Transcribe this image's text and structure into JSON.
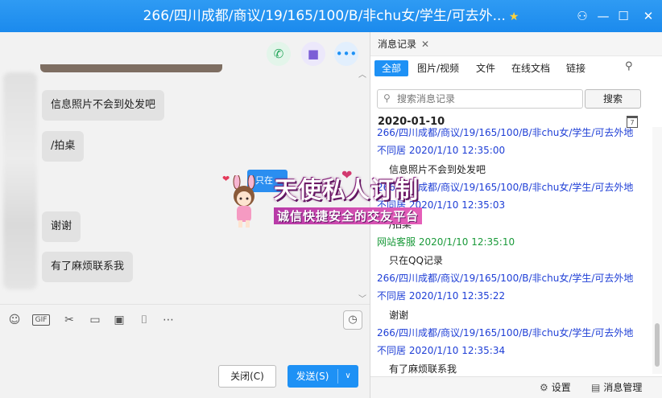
{
  "window": {
    "title": "266/四川成都/商议/19/165/100/B/非chu女/学生/可去外...",
    "title_badge": "★",
    "controls": {
      "skin": "⚇",
      "minimize": "—",
      "maximize": "☐",
      "close": "✕"
    }
  },
  "chat": {
    "actions": [
      {
        "name": "voice-call",
        "glyph": "✆",
        "color": "#22a65a",
        "bg": "#e3f5ea"
      },
      {
        "name": "video-call",
        "glyph": "■",
        "color": "#7b5ed6",
        "bg": "#ece8fb"
      },
      {
        "name": "more",
        "glyph": "•••",
        "color": "#1e91f5",
        "bg": "#e2effd"
      }
    ],
    "messages": [
      {
        "text": "信息照片不会到处发吧"
      },
      {
        "text": "/拍桌"
      },
      {
        "text": "谢谢"
      },
      {
        "text": "有了麻烦联系我"
      }
    ],
    "toolbar": {
      "emoji": "☺",
      "gif": "GIF",
      "screenshot": "✂",
      "folder": "▭",
      "image": "▣",
      "shake": "⌷",
      "more": "⋯",
      "history": "◷"
    },
    "close_label": "关闭(C)",
    "send_label": "发送(S)",
    "send_arrow": "∨"
  },
  "history": {
    "tab_title": "消息记录",
    "tab_close": "✕",
    "filters": [
      "全部",
      "图片/视频",
      "文件",
      "在线文档",
      "链接"
    ],
    "filter_icon": "⚲",
    "search_placeholder": "搜索消息记录",
    "search_button": "搜索",
    "date": "2020-01-10",
    "entries": [
      {
        "sender": "266/四川成都/商议/19/165/100/B/非chu女/学生/可去外地",
        "sender_cont": "不同居",
        "time": "2020/1/10 12:35:00",
        "message": "信息照片不会到处发吧",
        "type": "user"
      },
      {
        "sender": "266/四川成都/商议/19/165/100/B/非chu女/学生/可去外地",
        "sender_cont": "不同居",
        "time": "2020/1/10 12:35:03",
        "message": "/拍桌",
        "type": "user"
      },
      {
        "sender": "网站客服",
        "time": "2020/1/10 12:35:10",
        "message": "只在QQ记录",
        "type": "official"
      },
      {
        "sender": "266/四川成都/商议/19/165/100/B/非chu女/学生/可去外地",
        "sender_cont": "不同居",
        "time": "2020/1/10 12:35:22",
        "message": "谢谢",
        "type": "user"
      },
      {
        "sender": "266/四川成都/商议/19/165/100/B/非chu女/学生/可去外地",
        "sender_cont": "不同居",
        "time": "2020/1/10 12:35:34",
        "message": "有了麻烦联系我",
        "type": "user"
      }
    ],
    "settings_label": "设置",
    "manage_label": "消息管理"
  },
  "overlay": {
    "title": "天使私人订制",
    "subtitle": "诚信快捷安全的交友平台",
    "bubble_text": "只在"
  }
}
